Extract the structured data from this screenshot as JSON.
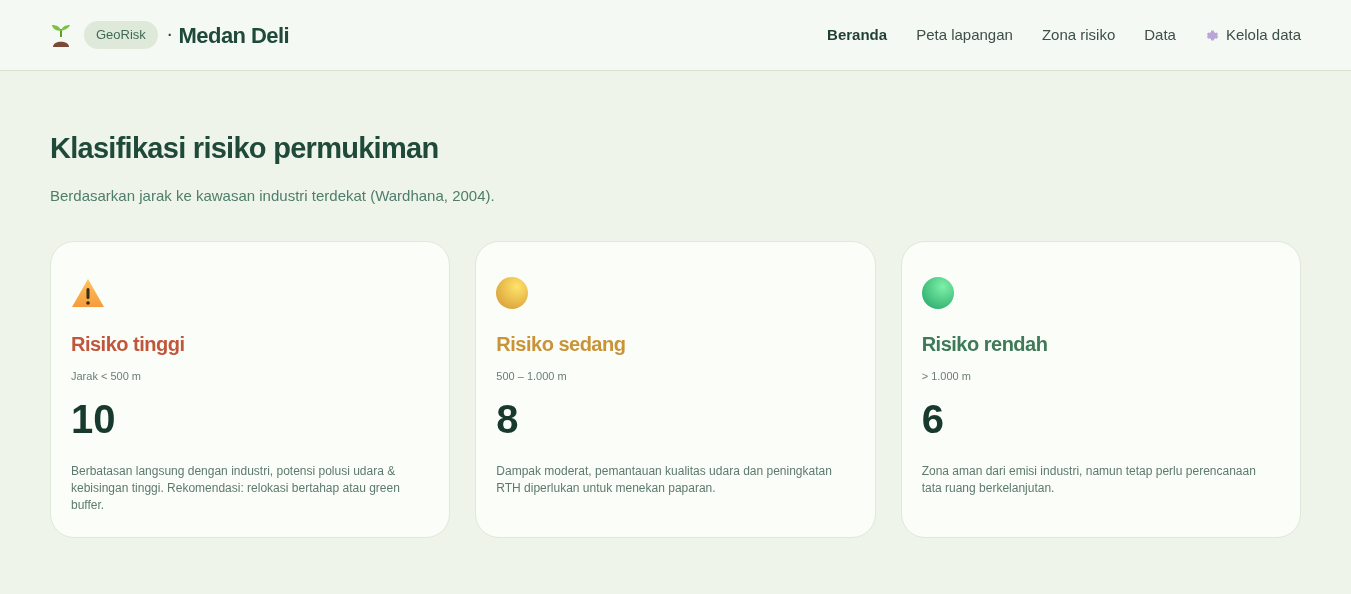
{
  "header": {
    "badge": "GeoRisk",
    "separator": "·",
    "title": "Medan Deli"
  },
  "nav": [
    {
      "label": "Beranda",
      "selected": true,
      "kind": "text"
    },
    {
      "label": "Peta lapangan",
      "selected": false,
      "kind": "text"
    },
    {
      "label": "Zona risiko",
      "selected": false,
      "kind": "text"
    },
    {
      "label": "Data",
      "selected": false,
      "kind": "text"
    },
    {
      "label": "Kelola data",
      "selected": false,
      "kind": "gear"
    }
  ],
  "heading": "Klasifikasi risiko permukiman",
  "subheading": "Berdasarkan jarak ke kawasan industri terdekat (Wardhana, 2004).",
  "cards": [
    {
      "kind": "warning",
      "title": "Risiko tinggi",
      "color": "#c0563b",
      "range": "Jarak < 500 m",
      "count": "10",
      "description": "Berbatasan langsung dengan industri, potensi polusi udara & kebisingan tinggi. Rekomendasi: relokasi bertahap atau green buffer."
    },
    {
      "kind": "yellow-ball",
      "title": "Risiko sedang",
      "color": "#c99338",
      "range": "500 – 1.000 m",
      "count": "8",
      "description": "Dampak moderat, pemantauan kualitas udara dan peningkatan RTH diperlukan untuk menekan paparan."
    },
    {
      "kind": "green-ball",
      "title": "Risiko rendah",
      "color": "#3e7a58",
      "range": "> 1.000 m",
      "count": "6",
      "description": "Zona aman dari emisi industri, namun tetap perlu perencanaan tata ruang berkelanjutan."
    }
  ]
}
